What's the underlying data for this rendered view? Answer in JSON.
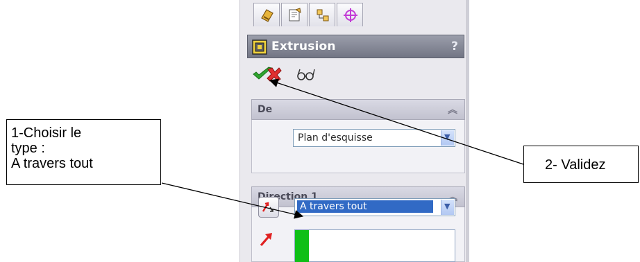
{
  "panel": {
    "tabs": [
      "feature-manager-icon",
      "property-manager-icon",
      "configuration-manager-icon",
      "dimxpert-icon"
    ],
    "title": "Extrusion",
    "help_label": "?",
    "actions": [
      "ok-check-icon",
      "cancel-x-icon",
      "preview-glasses-icon"
    ]
  },
  "from_group": {
    "header": "De",
    "start_condition": "Plan d'esquisse"
  },
  "direction1_group": {
    "header": "Direction 1",
    "end_condition": "A travers tout"
  },
  "callouts": {
    "choose_type": [
      "1-Choisir le",
      "type :",
      "A travers tout"
    ],
    "validate": "2- Validez"
  },
  "colors": {
    "ok": "#2fa52f",
    "cancel": "#e03030",
    "selection": "#316ac5",
    "direction_arrow": "#e02020",
    "depth_swatch": "#0fbf17"
  }
}
